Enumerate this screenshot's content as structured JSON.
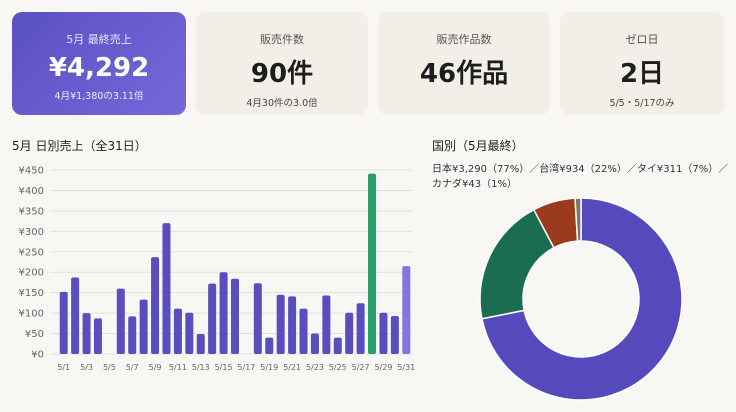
{
  "cards": [
    {
      "label": "5月 最終売上",
      "value": "¥4,292",
      "sub": "4月¥1,380の3.11倍"
    },
    {
      "label": "販売件数",
      "value": "90件",
      "sub": "4月30件の3.0倍"
    },
    {
      "label": "販売作品数",
      "value": "46作品",
      "sub": ""
    },
    {
      "label": "ゼロ日",
      "value": "2日",
      "sub": "5/5・5/17のみ"
    }
  ],
  "bar_section": {
    "title": "5月 日別売上（全31日）"
  },
  "pie_section": {
    "title": "国別（5月最終）",
    "legend": "日本¥3,290（77%）／台湾¥934（22%）／タイ¥311（7%）／カナダ¥43（1%）"
  },
  "colors": {
    "bar": "#5a4dbd",
    "bar_highlight": "#27a06b",
    "bar_last": "#8175e0",
    "pie": [
      "#5549bb",
      "#1b6d52",
      "#9b3a1c",
      "#7c7466"
    ]
  },
  "chart_data": [
    {
      "type": "bar",
      "title": "5月 日別売上（全31日）",
      "categories": [
        "5/1",
        "5/2",
        "5/3",
        "5/4",
        "5/5",
        "5/6",
        "5/7",
        "5/8",
        "5/9",
        "5/10",
        "5/11",
        "5/12",
        "5/13",
        "5/14",
        "5/15",
        "5/16",
        "5/17",
        "5/18",
        "5/19",
        "5/20",
        "5/21",
        "5/22",
        "5/23",
        "5/24",
        "5/25",
        "5/26",
        "5/27",
        "5/28",
        "5/29",
        "5/30",
        "5/31"
      ],
      "values": [
        152,
        187,
        100,
        87,
        0,
        160,
        92,
        133,
        237,
        320,
        111,
        101,
        49,
        172,
        200,
        184,
        0,
        173,
        40,
        145,
        141,
        111,
        50,
        143,
        40,
        101,
        124,
        441,
        101,
        93,
        215
      ],
      "tick_labels_x": [
        "5/1",
        "5/3",
        "5/5",
        "5/7",
        "5/9",
        "5/11",
        "5/13",
        "5/15",
        "5/17",
        "5/19",
        "5/21",
        "5/23",
        "5/25",
        "5/27",
        "5/29",
        "5/31"
      ],
      "y_ticks": [
        "¥0",
        "¥50",
        "¥100",
        "¥150",
        "¥200",
        "¥250",
        "¥300",
        "¥350",
        "¥400",
        "¥450"
      ],
      "ylim": [
        0,
        450
      ],
      "grid": true,
      "highlight_index": 27
    },
    {
      "type": "pie",
      "title": "国別（5月最終）",
      "labels": [
        "日本",
        "台湾",
        "タイ",
        "カナダ"
      ],
      "values": [
        3290,
        934,
        311,
        43
      ]
    }
  ]
}
